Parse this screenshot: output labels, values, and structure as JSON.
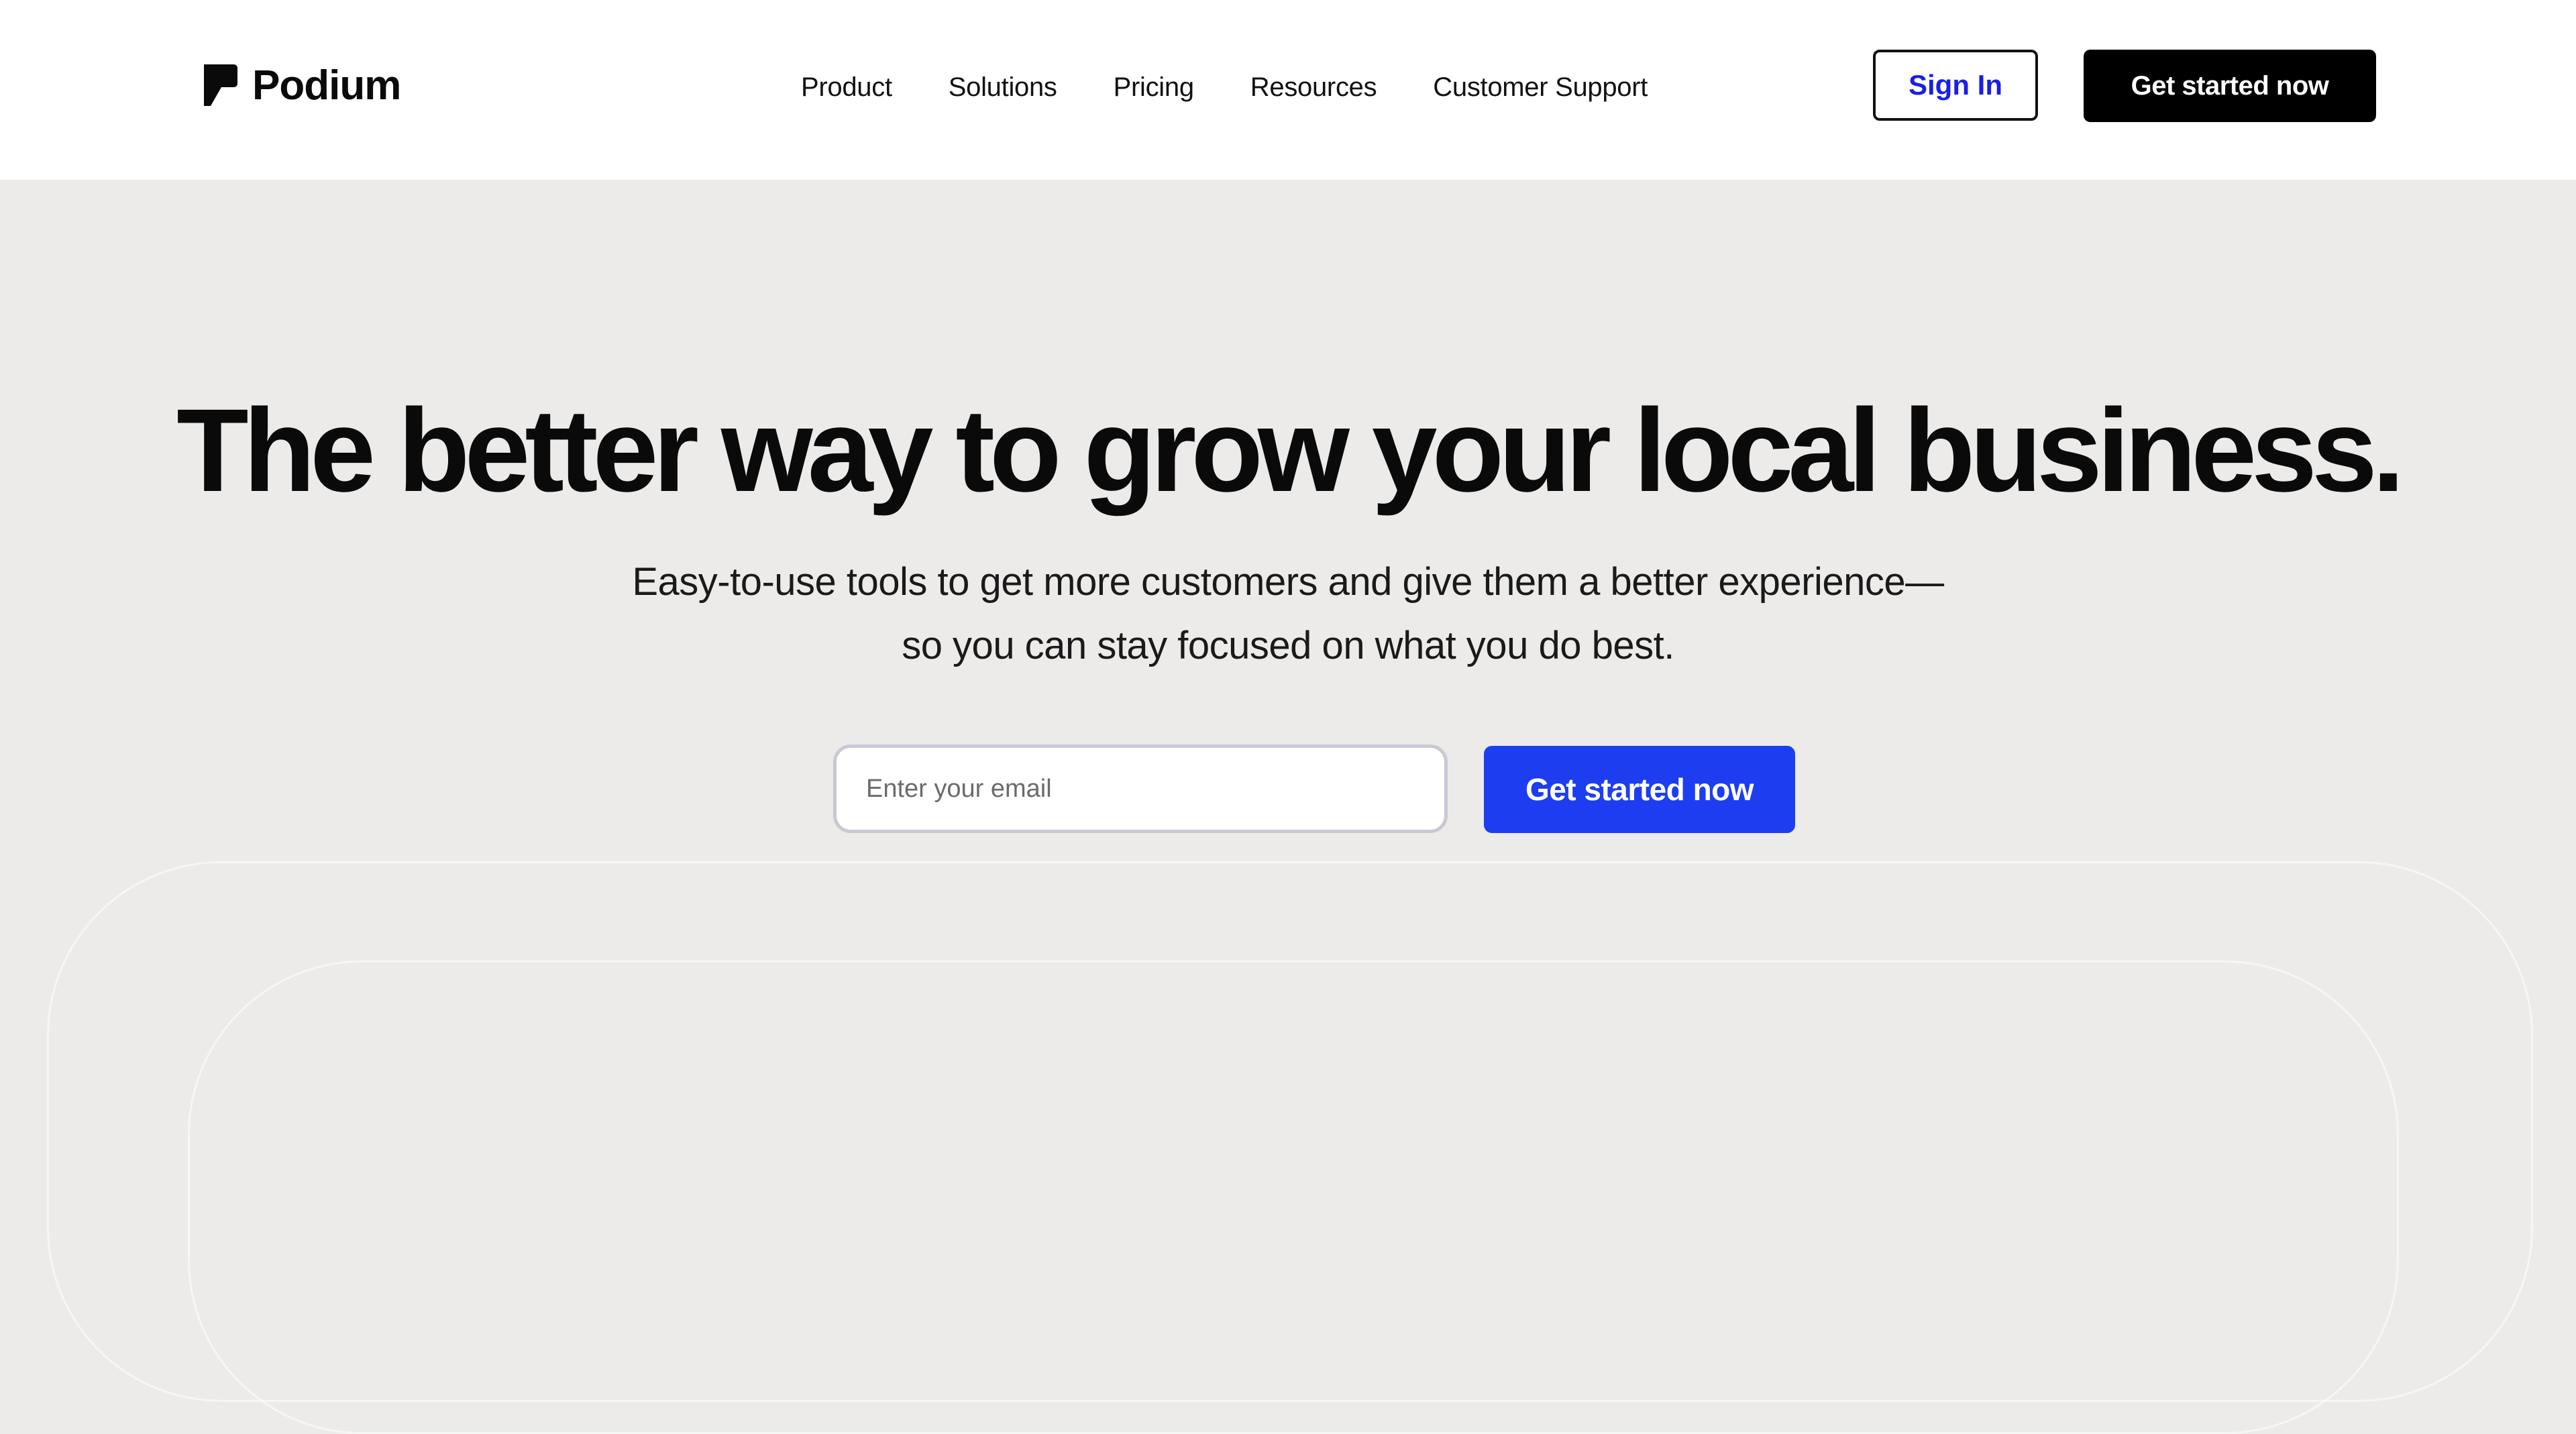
{
  "header": {
    "logo_text": "Podium",
    "nav": [
      {
        "label": "Product"
      },
      {
        "label": "Solutions"
      },
      {
        "label": "Pricing"
      },
      {
        "label": "Resources"
      },
      {
        "label": "Customer Support"
      }
    ],
    "sign_in_label": "Sign In",
    "get_started_label": "Get started now"
  },
  "hero": {
    "title": "The better way to grow your local business.",
    "subtitle_line1": "Easy-to-use tools to get more customers and give them a better experience—",
    "subtitle_line2": "so you can stay focused on what you do best.",
    "email_placeholder": "Enter your email",
    "email_value": "",
    "cta_label": "Get started now"
  },
  "colors": {
    "page_background": "#ecebe9",
    "header_background": "#ffffff",
    "cta_blue": "#1d3ef0",
    "sign_in_text": "#1a1ee6",
    "black": "#000000"
  },
  "icons": {
    "logo": "podium-logo-icon"
  }
}
